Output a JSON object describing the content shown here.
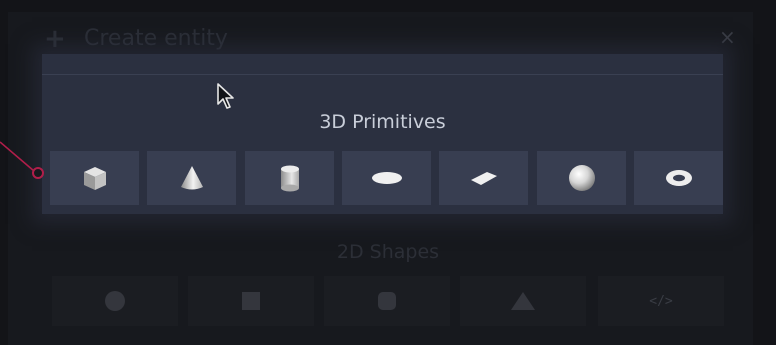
{
  "dialog": {
    "title": "Create entity",
    "plus_icon": "+",
    "close_icon": "×"
  },
  "sections": {
    "primitives_3d": {
      "title": "3D Primitives",
      "items": [
        {
          "icon": "cube-icon"
        },
        {
          "icon": "cone-icon"
        },
        {
          "icon": "cylinder-icon"
        },
        {
          "icon": "disc-icon"
        },
        {
          "icon": "plane-icon"
        },
        {
          "icon": "sphere-icon"
        },
        {
          "icon": "torus-icon"
        }
      ]
    },
    "shapes_2d": {
      "title": "2D Shapes",
      "items": [
        {
          "icon": "circle-icon"
        },
        {
          "icon": "square-icon"
        },
        {
          "icon": "rounded-square-icon"
        },
        {
          "icon": "triangle-icon"
        },
        {
          "icon": "code-icon",
          "label": "</>"
        }
      ]
    }
  },
  "colors": {
    "panel_highlight": "#2b3040",
    "tile": "#383e51",
    "annotation": "#b01e4a"
  }
}
